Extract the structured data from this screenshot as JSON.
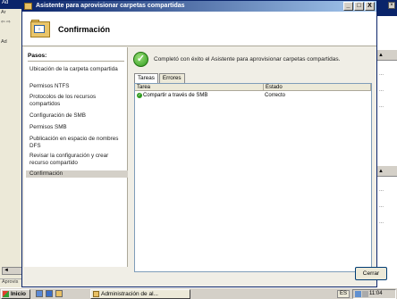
{
  "background_app": {
    "title": "Ad",
    "rows": [
      "Ar",
      "⇦ ⇨",
      "Ad"
    ],
    "status": "Aprovis",
    "scroll": "◄"
  },
  "wizard": {
    "title": "Asistente para aprovisionar carpetas compartidas",
    "header_title": "Confirmación",
    "steps_label": "Pasos:",
    "steps": [
      "Ubicación de la carpeta compartida",
      "Permisos NTFS",
      "Protocolos de los recursos compartidos",
      "Configuración de SMB",
      "Permisos SMB",
      "Publicación en espacio de nombres DFS",
      "Revisar la configuración y crear recurso compartido",
      "Confirmación"
    ],
    "success_message": "Completó con éxito el Asistente para aprovisionar carpetas compartidas.",
    "tabs": [
      "Tareas",
      "Errores"
    ],
    "table": {
      "headers": [
        "Tarea",
        "Estado"
      ],
      "rows": [
        {
          "task": "Compartir a través de SMB",
          "state": "Correcto"
        }
      ]
    },
    "close_button": "Cerrar",
    "title_buttons": [
      "_",
      "□",
      "X"
    ]
  },
  "taskbar": {
    "start_label": "Inicio",
    "task_label": "Administración de al...",
    "language": "ES",
    "clock": "11:04"
  },
  "colors": {
    "titlebar": "#0a246a",
    "success": "#2e9a1e"
  }
}
